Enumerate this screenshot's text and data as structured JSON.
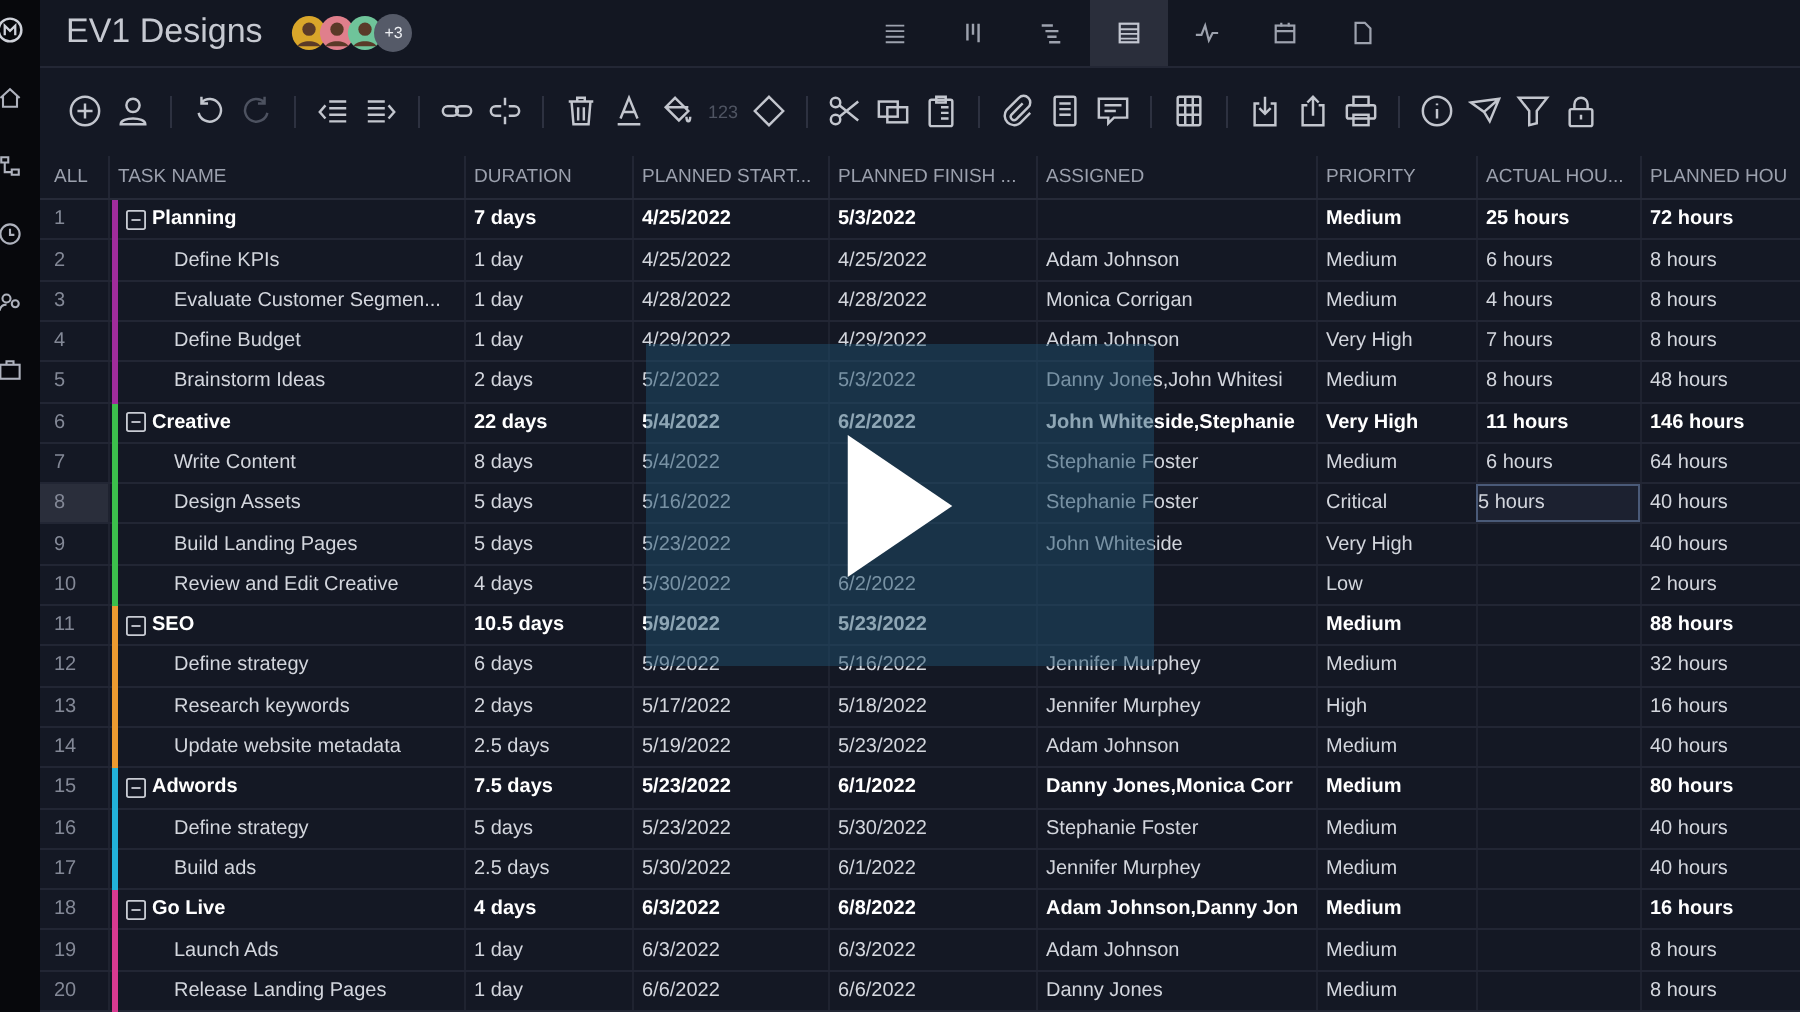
{
  "project": {
    "title": "EV1 Designs",
    "avatars": [
      {
        "color": "#d9a62a"
      },
      {
        "color": "#e07f8c"
      },
      {
        "color": "#6fc49a"
      }
    ],
    "more_members": "+3"
  },
  "views": [
    {
      "kind": "list",
      "selected": false
    },
    {
      "kind": "board",
      "selected": false
    },
    {
      "kind": "gantt",
      "selected": false
    },
    {
      "kind": "sheet",
      "selected": true
    },
    {
      "kind": "dashboard",
      "selected": false
    },
    {
      "kind": "calendar",
      "selected": false
    },
    {
      "kind": "files",
      "selected": false
    }
  ],
  "toolbar": {
    "undo": {
      "disabled": false
    },
    "redo": {
      "disabled": true
    },
    "number_format_label": "123"
  },
  "table": {
    "columns": [
      "ALL",
      "TASK NAME",
      "DURATION",
      "PLANNED START...",
      "PLANNED FINISH ...",
      "ASSIGNED",
      "PRIORITY",
      "ACTUAL HOU...",
      "PLANNED HOU"
    ],
    "groups": [
      {
        "num": "1",
        "name": "Planning",
        "expanded": true,
        "selected": false,
        "color": "#a02c9c",
        "duration": "7 days",
        "start": "4/25/2022",
        "finish": "5/3/2022",
        "priority": "Medium",
        "actual": "25 hours",
        "planned": "72 hours",
        "children": [
          {
            "num": "2",
            "name": "Define KPIs",
            "selected": false,
            "duration": "1 day",
            "start": "4/25/2022",
            "finish": "4/25/2022",
            "assigned": "Adam Johnson",
            "priority": "Medium",
            "actual": "6 hours",
            "planned": "8 hours"
          },
          {
            "num": "3",
            "name": "Evaluate Customer Segmen...",
            "selected": false,
            "duration": "1 day",
            "start": "4/28/2022",
            "finish": "4/28/2022",
            "assigned": "Monica Corrigan",
            "priority": "Medium",
            "actual": "4 hours",
            "planned": "8 hours"
          },
          {
            "num": "4",
            "name": "Define Budget",
            "selected": false,
            "duration": "1 day",
            "start": "4/29/2022",
            "finish": "4/29/2022",
            "assigned": "Adam Johnson",
            "priority": "Very High",
            "actual": "7 hours",
            "planned": "8 hours"
          },
          {
            "num": "5",
            "name": "Brainstorm Ideas",
            "selected": false,
            "duration": "2 days",
            "start": "5/2/2022",
            "finish": "5/3/2022",
            "assigned": "Danny Jones,John Whitesi",
            "priority": "Medium",
            "actual": "8 hours",
            "planned": "48 hours"
          }
        ]
      },
      {
        "num": "6",
        "name": "Creative",
        "expanded": true,
        "selected": false,
        "color": "#3cbf4c",
        "duration": "22 days",
        "start": "5/4/2022",
        "finish": "6/2/2022",
        "assigned": "John Whiteside,Stephanie",
        "priority": "Very High",
        "actual": "11 hours",
        "planned": "146 hours",
        "children": [
          {
            "num": "7",
            "name": "Write Content",
            "selected": false,
            "duration": "8 days",
            "start": "5/4/2022",
            "assigned": "Stephanie Foster",
            "priority": "Medium",
            "actual": "6 hours",
            "planned": "64 hours"
          },
          {
            "num": "8",
            "name": "Design Assets",
            "selected": true,
            "duration": "5 days",
            "start": "5/16/2022",
            "assigned": "Stephanie Foster",
            "priority": "Critical",
            "actual": "5 hours",
            "planned": "40 hours"
          },
          {
            "num": "9",
            "name": "Build Landing Pages",
            "selected": false,
            "duration": "5 days",
            "start": "5/23/2022",
            "assigned": "John Whiteside",
            "priority": "Very High",
            "planned": "40 hours"
          },
          {
            "num": "10",
            "name": "Review and Edit Creative",
            "selected": false,
            "duration": "4 days",
            "start": "5/30/2022",
            "finish": "6/2/2022",
            "priority": "Low",
            "planned": "2 hours"
          }
        ]
      },
      {
        "num": "11",
        "name": "SEO",
        "expanded": true,
        "selected": false,
        "color": "#ec9a30",
        "duration": "10.5 days",
        "start": "5/9/2022",
        "finish": "5/23/2022",
        "priority": "Medium",
        "planned": "88 hours",
        "children": [
          {
            "num": "12",
            "name": "Define strategy",
            "selected": false,
            "duration": "6 days",
            "start": "5/9/2022",
            "finish": "5/16/2022",
            "assigned": "Jennifer Murphey",
            "priority": "Medium",
            "planned": "32 hours"
          },
          {
            "num": "13",
            "name": "Research keywords",
            "selected": false,
            "duration": "2 days",
            "start": "5/17/2022",
            "finish": "5/18/2022",
            "assigned": "Jennifer Murphey",
            "priority": "High",
            "planned": "16 hours"
          },
          {
            "num": "14",
            "name": "Update website metadata",
            "selected": false,
            "duration": "2.5 days",
            "start": "5/19/2022",
            "finish": "5/23/2022",
            "assigned": "Adam Johnson",
            "priority": "Medium",
            "planned": "40 hours"
          }
        ]
      },
      {
        "num": "15",
        "name": "Adwords",
        "expanded": true,
        "selected": false,
        "color": "#22b2da",
        "duration": "7.5 days",
        "start": "5/23/2022",
        "finish": "6/1/2022",
        "assigned": "Danny Jones,Monica Corr",
        "priority": "Medium",
        "planned": "80 hours",
        "children": [
          {
            "num": "16",
            "name": "Define strategy",
            "selected": false,
            "duration": "5 days",
            "start": "5/23/2022",
            "finish": "5/30/2022",
            "assigned": "Stephanie Foster",
            "priority": "Medium",
            "planned": "40 hours"
          },
          {
            "num": "17",
            "name": "Build ads",
            "selected": false,
            "duration": "2.5 days",
            "start": "5/30/2022",
            "finish": "6/1/2022",
            "assigned": "Jennifer Murphey",
            "priority": "Medium",
            "planned": "40 hours"
          }
        ]
      },
      {
        "num": "18",
        "name": "Go Live",
        "expanded": true,
        "selected": false,
        "color": "#d83a90",
        "duration": "4 days",
        "start": "6/3/2022",
        "finish": "6/8/2022",
        "assigned": "Adam Johnson,Danny Jon",
        "priority": "Medium",
        "planned": "16 hours",
        "children": [
          {
            "num": "19",
            "name": "Launch Ads",
            "selected": false,
            "duration": "1 day",
            "start": "6/3/2022",
            "finish": "6/3/2022",
            "assigned": "Adam Johnson",
            "priority": "Medium",
            "planned": "8 hours"
          },
          {
            "num": "20",
            "name": "Release Landing Pages",
            "selected": false,
            "duration": "1 day",
            "start": "6/6/2022",
            "finish": "6/6/2022",
            "assigned": "Danny Jones",
            "priority": "Medium",
            "planned": "8 hours"
          }
        ]
      }
    ]
  },
  "video": {
    "kind": "play_overlay"
  }
}
